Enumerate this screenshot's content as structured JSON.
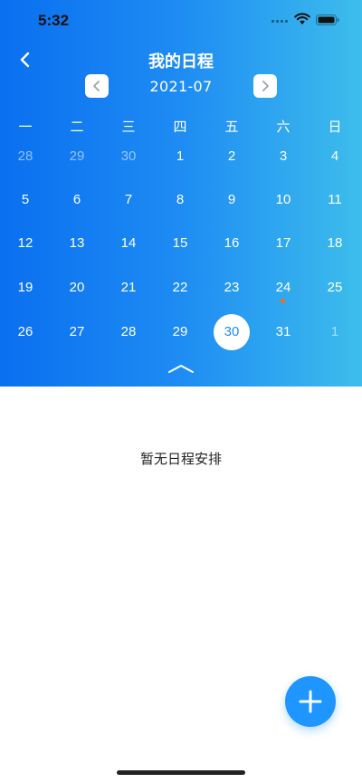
{
  "status_bar": {
    "time": "5:32"
  },
  "header": {
    "title": "我的日程",
    "back_icon": "chevron-left-icon"
  },
  "month_nav": {
    "label": "2021-07",
    "prev_icon": "chevron-left-icon",
    "next_icon": "chevron-right-icon"
  },
  "weekdays": [
    "一",
    "二",
    "三",
    "四",
    "五",
    "六",
    "日"
  ],
  "weeks": [
    [
      {
        "d": "28",
        "muted": true
      },
      {
        "d": "29",
        "muted": true
      },
      {
        "d": "30",
        "muted": true
      },
      {
        "d": "1"
      },
      {
        "d": "2"
      },
      {
        "d": "3"
      },
      {
        "d": "4"
      }
    ],
    [
      {
        "d": "5"
      },
      {
        "d": "6"
      },
      {
        "d": "7"
      },
      {
        "d": "8"
      },
      {
        "d": "9"
      },
      {
        "d": "10"
      },
      {
        "d": "11"
      }
    ],
    [
      {
        "d": "12"
      },
      {
        "d": "13"
      },
      {
        "d": "14"
      },
      {
        "d": "15"
      },
      {
        "d": "16"
      },
      {
        "d": "17"
      },
      {
        "d": "18"
      }
    ],
    [
      {
        "d": "19"
      },
      {
        "d": "20"
      },
      {
        "d": "21"
      },
      {
        "d": "22"
      },
      {
        "d": "23"
      },
      {
        "d": "24",
        "event": true
      },
      {
        "d": "25"
      }
    ],
    [
      {
        "d": "26"
      },
      {
        "d": "27"
      },
      {
        "d": "28"
      },
      {
        "d": "29"
      },
      {
        "d": "30",
        "selected": true
      },
      {
        "d": "31"
      },
      {
        "d": "1",
        "muted": true
      }
    ]
  ],
  "empty_message": "暂无日程安排",
  "fab": {
    "icon": "plus-icon"
  },
  "colors": {
    "gradient_start": "#0a6ff0",
    "gradient_end": "#3dbdec",
    "accent": "#1e95ff",
    "event_dot": "#ff6a1a"
  }
}
